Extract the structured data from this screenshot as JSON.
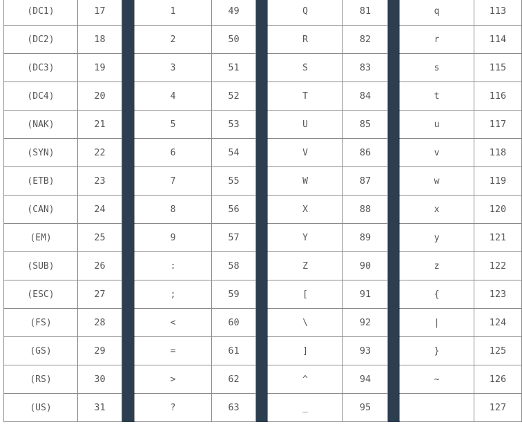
{
  "table": {
    "rows": [
      {
        "c0": "(DC1)",
        "d0": "17",
        "c1": "1",
        "d1": "49",
        "c2": "Q",
        "d2": "81",
        "c3": "q",
        "d3": "113"
      },
      {
        "c0": "(DC2)",
        "d0": "18",
        "c1": "2",
        "d1": "50",
        "c2": "R",
        "d2": "82",
        "c3": "r",
        "d3": "114"
      },
      {
        "c0": "(DC3)",
        "d0": "19",
        "c1": "3",
        "d1": "51",
        "c2": "S",
        "d2": "83",
        "c3": "s",
        "d3": "115"
      },
      {
        "c0": "(DC4)",
        "d0": "20",
        "c1": "4",
        "d1": "52",
        "c2": "T",
        "d2": "84",
        "c3": "t",
        "d3": "116"
      },
      {
        "c0": "(NAK)",
        "d0": "21",
        "c1": "5",
        "d1": "53",
        "c2": "U",
        "d2": "85",
        "c3": "u",
        "d3": "117"
      },
      {
        "c0": "(SYN)",
        "d0": "22",
        "c1": "6",
        "d1": "54",
        "c2": "V",
        "d2": "86",
        "c3": "v",
        "d3": "118"
      },
      {
        "c0": "(ETB)",
        "d0": "23",
        "c1": "7",
        "d1": "55",
        "c2": "W",
        "d2": "87",
        "c3": "w",
        "d3": "119"
      },
      {
        "c0": "(CAN)",
        "d0": "24",
        "c1": "8",
        "d1": "56",
        "c2": "X",
        "d2": "88",
        "c3": "x",
        "d3": "120"
      },
      {
        "c0": "(EM)",
        "d0": "25",
        "c1": "9",
        "d1": "57",
        "c2": "Y",
        "d2": "89",
        "c3": "y",
        "d3": "121"
      },
      {
        "c0": "(SUB)",
        "d0": "26",
        "c1": ":",
        "d1": "58",
        "c2": "Z",
        "d2": "90",
        "c3": "z",
        "d3": "122"
      },
      {
        "c0": "(ESC)",
        "d0": "27",
        "c1": ";",
        "d1": "59",
        "c2": "[",
        "d2": "91",
        "c3": "{",
        "d3": "123"
      },
      {
        "c0": "(FS)",
        "d0": "28",
        "c1": "<",
        "d1": "60",
        "c2": "\\",
        "d2": "92",
        "c3": "|",
        "d3": "124"
      },
      {
        "c0": "(GS)",
        "d0": "29",
        "c1": "=",
        "d1": "61",
        "c2": "]",
        "d2": "93",
        "c3": "}",
        "d3": "125"
      },
      {
        "c0": "(RS)",
        "d0": "30",
        "c1": ">",
        "d1": "62",
        "c2": "^",
        "d2": "94",
        "c3": "~",
        "d3": "126"
      },
      {
        "c0": "(US)",
        "d0": "31",
        "c1": "?",
        "d1": "63",
        "c2": "_",
        "d2": "95",
        "c3": "",
        "d3": "127"
      }
    ]
  },
  "colors": {
    "separator": "#2c3e50",
    "border": "#8a8a8a",
    "text": "#555555"
  }
}
